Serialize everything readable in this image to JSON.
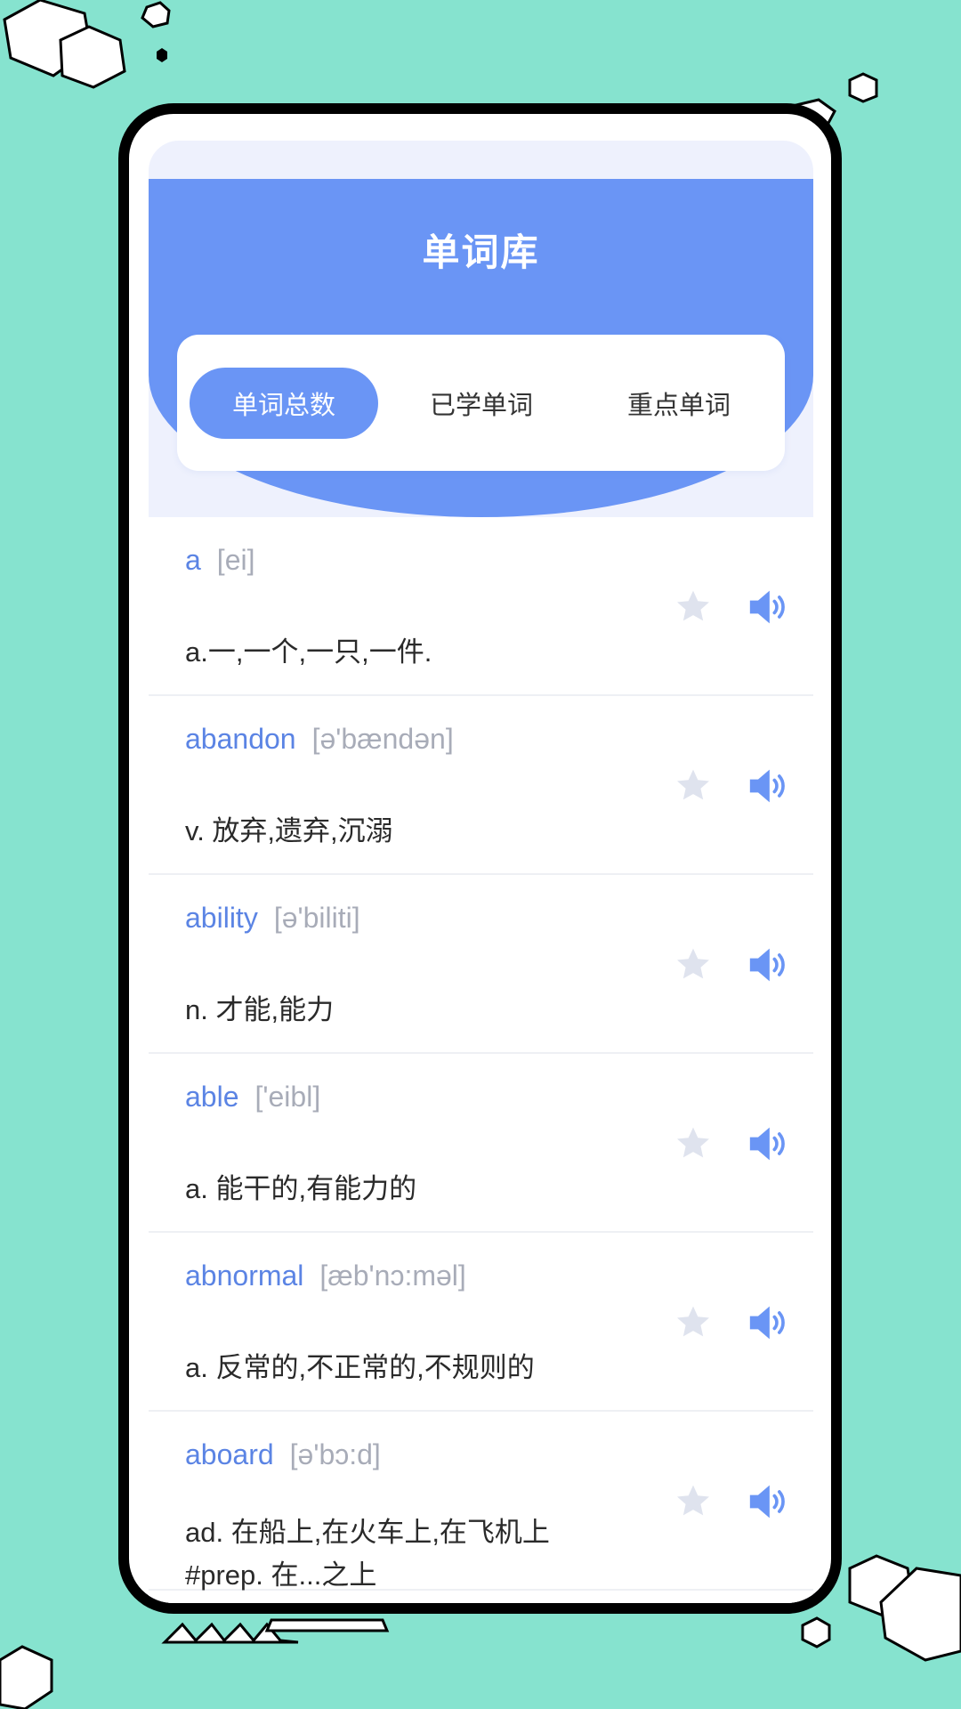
{
  "header": {
    "title": "单词库"
  },
  "tabs": [
    {
      "label": "单词总数",
      "active": true
    },
    {
      "label": "已学单词",
      "active": false
    },
    {
      "label": "重点单词",
      "active": false
    }
  ],
  "words": [
    {
      "word": "a",
      "phonetic": "[ei]",
      "meaning": "a.一,一个,一只,一件."
    },
    {
      "word": "abandon",
      "phonetic": "[ə'bændən]",
      "meaning": "v. 放弃,遗弃,沉溺"
    },
    {
      "word": "ability",
      "phonetic": "[ə'biliti]",
      "meaning": "n. 才能,能力"
    },
    {
      "word": "able",
      "phonetic": "['eibl]",
      "meaning": "a. 能干的,有能力的"
    },
    {
      "word": "abnormal",
      "phonetic": "[æb'nɔ:məl]",
      "meaning": "a. 反常的,不正常的,不规则的"
    },
    {
      "word": "aboard",
      "phonetic": "[ə'bɔ:d]",
      "meaning": "ad. 在船上,在火车上,在飞机上 #prep. 在...之上"
    }
  ],
  "icons": {
    "favorite": "star-icon",
    "pronounce": "speaker-icon"
  },
  "colors": {
    "background": "#86e3cf",
    "accent": "#6a95f5",
    "word": "#5b84e4",
    "star_inactive": "#dfe3ee"
  }
}
